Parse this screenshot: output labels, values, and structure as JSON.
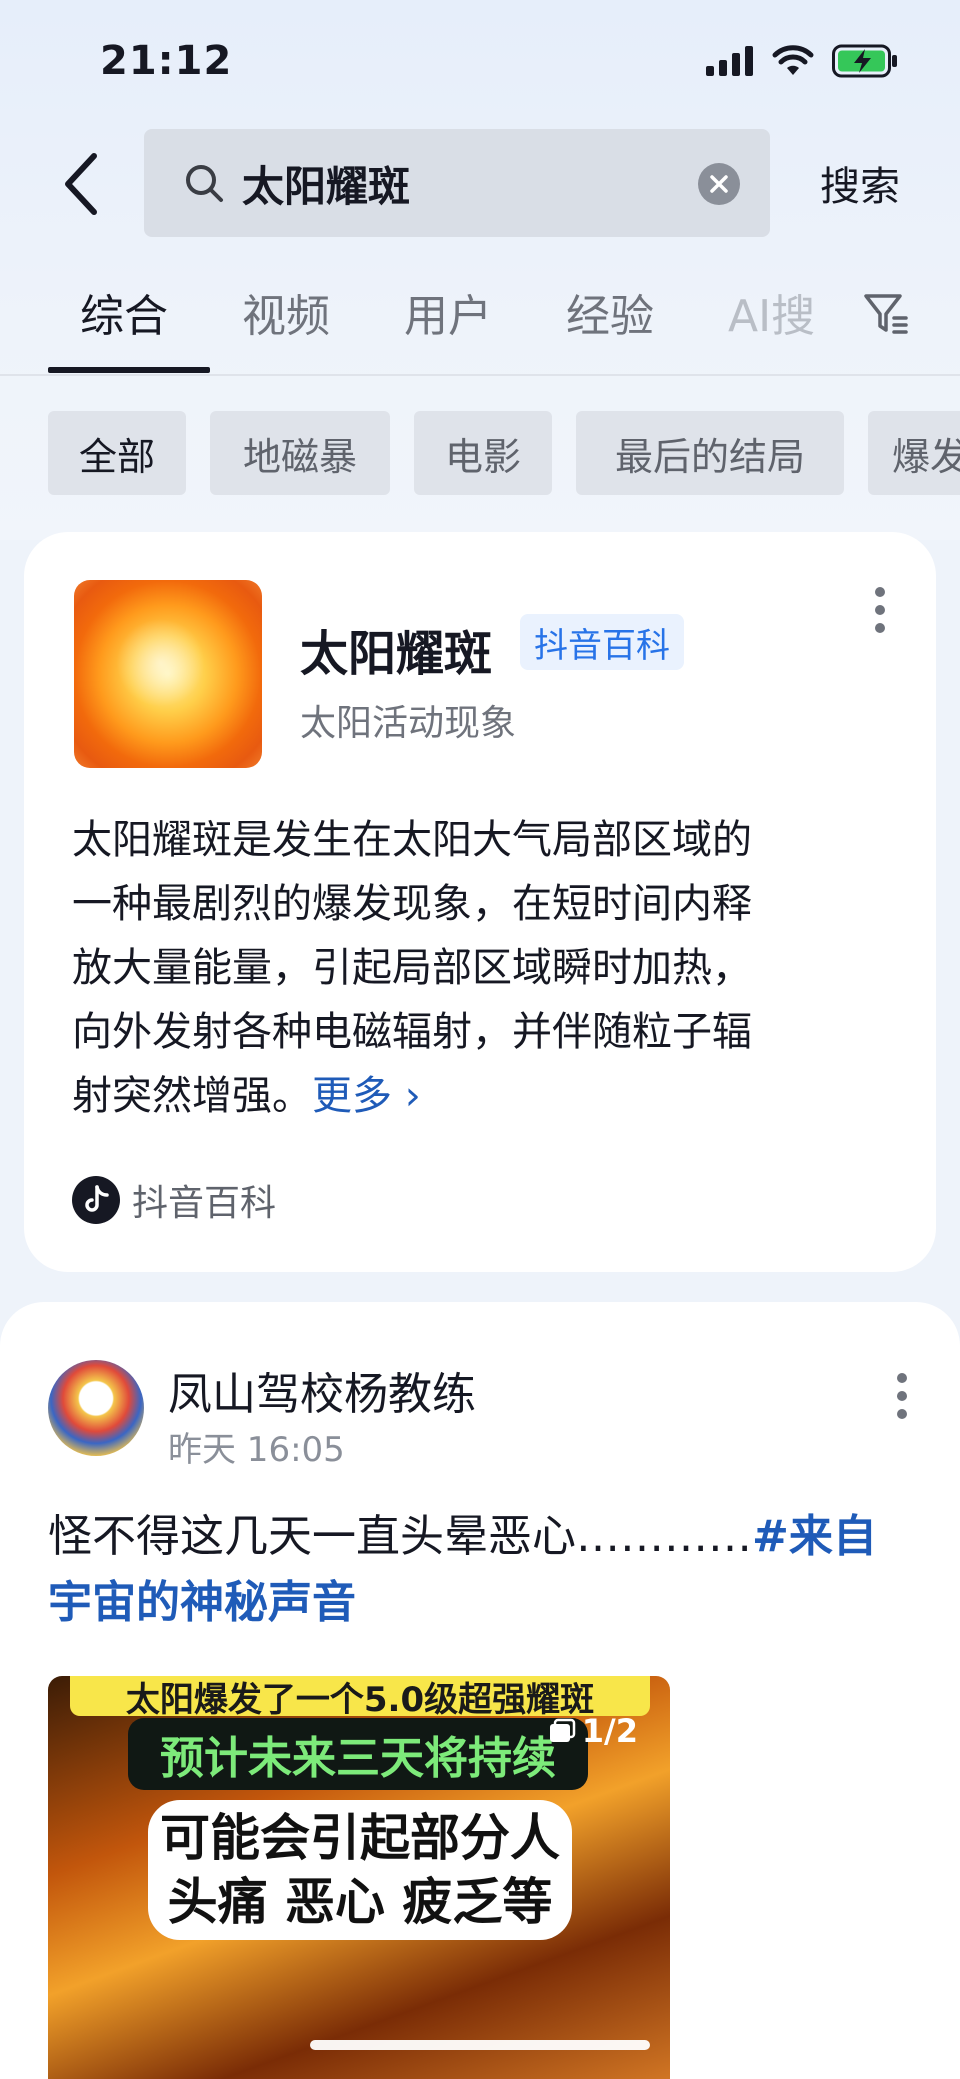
{
  "status_bar": {
    "time": "21:12"
  },
  "search": {
    "query": "太阳耀斑",
    "submit_label": "搜索"
  },
  "tabs": [
    "综合",
    "视频",
    "用户",
    "经验",
    "AI搜"
  ],
  "chips": [
    "全部",
    "地磁暴",
    "电影",
    "最后的结局",
    "爆发"
  ],
  "baike_card": {
    "title": "太阳耀斑",
    "badge": "抖音百科",
    "subtitle": "太阳活动现象",
    "description_lines": [
      "太阳耀斑是发生在太阳大气局部区域的",
      "一种最剧烈的爆发现象，在短时间内释",
      "放大量能量，引起局部区域瞬时加热，",
      "向外发射各种电磁辐射，并伴随粒子辐",
      "射突然增强。"
    ],
    "more_label": "更多 ›",
    "source_label": "抖音百科"
  },
  "post": {
    "author": "凤山驾校杨教练",
    "time": "昨天 16:05",
    "text": "怪不得这几天一直头晕恶心…………",
    "hashtag": "#来自宇宙的神秘声音",
    "media": {
      "banner_top": "太阳爆发了一个5.0级超强耀斑",
      "banner_mid": "预计未来三天将持续",
      "banner_main_line1": "可能会引起部分人",
      "banner_main_line2": "头痛 恶心 疲乏等",
      "counter": "1/2"
    }
  },
  "colors": {
    "link_blue": "#1f5bb8",
    "badge_blue": "#2773e8",
    "page_bg": "#eef3fa"
  }
}
